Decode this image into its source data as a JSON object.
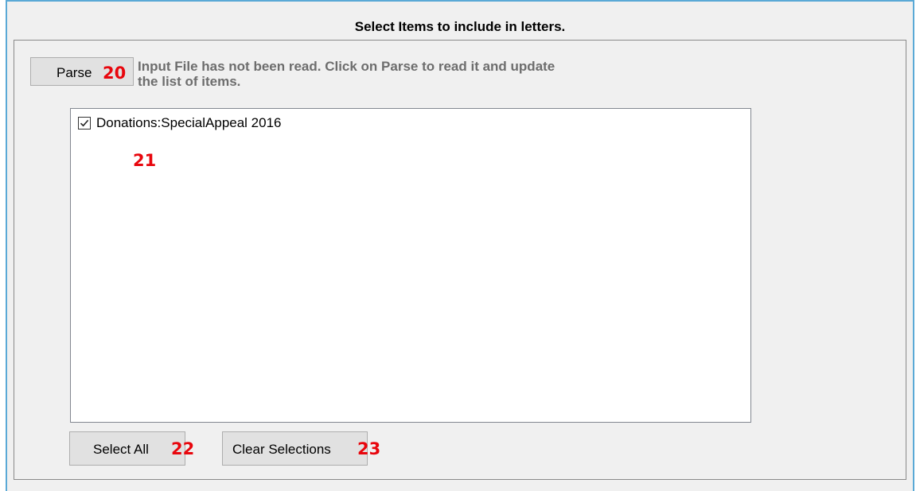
{
  "panel": {
    "heading": "Select Items to include in letters."
  },
  "parse": {
    "label": "Parse",
    "marker": "20",
    "status_line1": "Input File has not been read.  Click on Parse to read it and update",
    "status_line2": "the list of items."
  },
  "items_list": {
    "marker": "21",
    "items": [
      {
        "label": "Donations:SpecialAppeal 2016",
        "checked": true
      }
    ]
  },
  "select_all": {
    "label": "Select All",
    "marker": "22"
  },
  "clear_selections": {
    "label": "Clear Selections",
    "marker": "23"
  },
  "colors": {
    "annotation_red": "#e8060d",
    "frame_blue": "#5aa9d6",
    "panel_bg": "#f0f0f0",
    "status_text": "#6d6d6d"
  }
}
